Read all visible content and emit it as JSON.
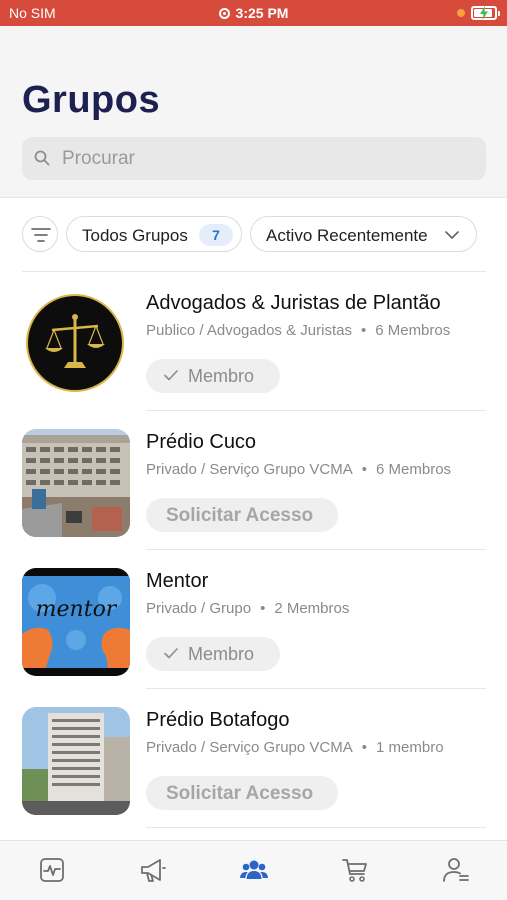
{
  "status_bar": {
    "carrier": "No SIM",
    "time": "3:25 PM"
  },
  "header": {
    "title": "Grupos",
    "search_placeholder": "Procurar"
  },
  "filters": {
    "all_label": "Todos Grupos",
    "all_count": "7",
    "sort_label": "Activo Recentemente"
  },
  "groups": [
    {
      "name": "Advogados & Juristas de Plantão",
      "type": "Publico / Advogados & Juristas",
      "members": "6 Membros",
      "action": "Membro",
      "action_type": "member",
      "image": "scales-of-justice"
    },
    {
      "name": "Prédio Cuco",
      "type": "Privado / Serviço Grupo VCMA",
      "members": "6 Membros",
      "action": "Solicitar Acesso",
      "action_type": "request",
      "image": "building-photo"
    },
    {
      "name": "Mentor",
      "type": "Privado / Grupo",
      "members": "2 Membros",
      "action": "Membro",
      "action_type": "member",
      "image": "mentor-illustration",
      "image_text": "mentor"
    },
    {
      "name": "Prédio Botafogo",
      "type": "Privado / Serviço Grupo VCMA",
      "members": "1 membro",
      "action": "Solicitar Acesso",
      "action_type": "request",
      "image": "building-photo"
    }
  ],
  "colors": {
    "status_bar": "#d64b3c",
    "title": "#1d2150",
    "accent": "#2a6fd6",
    "active_tab": "#2d64c8",
    "inactive_tab": "#6e6e6e"
  },
  "tabs": [
    {
      "icon": "activity-icon",
      "active": false
    },
    {
      "icon": "megaphone-icon",
      "active": false
    },
    {
      "icon": "groups-icon",
      "active": true
    },
    {
      "icon": "cart-icon",
      "active": false
    },
    {
      "icon": "profile-icon",
      "active": false
    }
  ]
}
